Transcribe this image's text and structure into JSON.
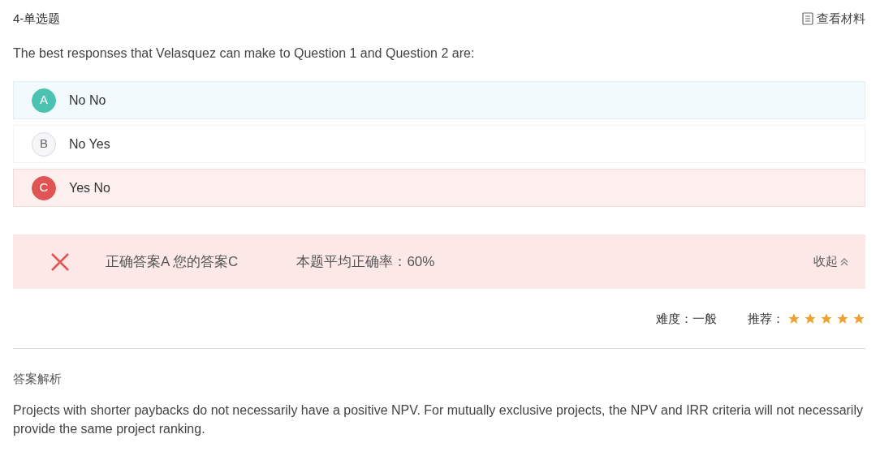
{
  "header": {
    "title": "4-单选题",
    "material_link": "查看材料"
  },
  "question": "The best responses that Velasquez can make to Question 1 and Question 2 are:",
  "options": [
    {
      "letter": "A",
      "text": "No No",
      "correct": true,
      "selected": false
    },
    {
      "letter": "B",
      "text": "No Yes",
      "correct": false,
      "selected": false
    },
    {
      "letter": "C",
      "text": "Yes No",
      "correct": false,
      "selected": true
    }
  ],
  "result": {
    "is_correct": false,
    "answers": "正确答案A 您的答案C",
    "accuracy": "本题平均正确率：60%",
    "collapse": "收起"
  },
  "meta": {
    "difficulty": "难度：一般",
    "recommend_label": "推荐：",
    "stars": 5
  },
  "analysis": {
    "heading": "答案解析",
    "text": "Projects with shorter paybacks do not necessarily have a positive NPV. For mutually exclusive projects, the NPV and IRR criteria will not necessarily provide the same project ranking."
  }
}
